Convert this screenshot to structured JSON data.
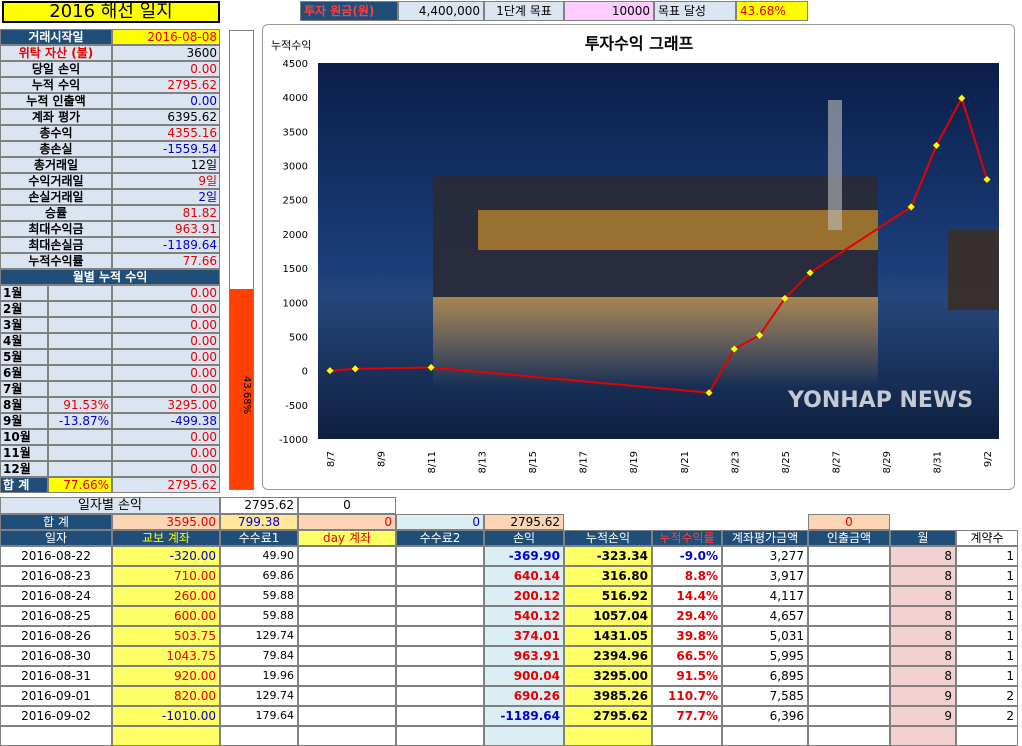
{
  "title": "2016 해선 일지",
  "top_bar": {
    "principal_label": "투자 원금(원)",
    "principal_value": "4,400,000",
    "stage_label": "1단계 목표",
    "stage_value": "10000",
    "goal_label": "목표 달성",
    "goal_value": "43.68%"
  },
  "summary": [
    {
      "label": "거래시작일",
      "value": "2016-08-08",
      "label_style": "hdr",
      "value_style": "yel-red"
    },
    {
      "label": "위탁 자산 (불)",
      "value": "3600",
      "label_style": "red",
      "value_style": "plain"
    },
    {
      "label": "당일 손익",
      "value": "0.00",
      "label_style": "plain",
      "value_style": "red"
    },
    {
      "label": "누적 수익",
      "value": "2795.62",
      "label_style": "plain",
      "value_style": "red"
    },
    {
      "label": "누적 인출액",
      "value": "0.00",
      "label_style": "plain",
      "value_style": "blue"
    },
    {
      "label": "계좌 평가",
      "value": "6395.62",
      "label_style": "plain",
      "value_style": "plain"
    },
    {
      "label": "총수익",
      "value": "4355.16",
      "label_style": "plain",
      "value_style": "red"
    },
    {
      "label": "총손실",
      "value": "-1559.54",
      "label_style": "plain",
      "value_style": "blue"
    },
    {
      "label": "총거래일",
      "value": "12일",
      "label_style": "plain",
      "value_style": "plain"
    },
    {
      "label": "수익거래일",
      "value": "9일",
      "label_style": "plain",
      "value_style": "red"
    },
    {
      "label": "손실거래일",
      "value": "2일",
      "label_style": "plain",
      "value_style": "blue"
    },
    {
      "label": "승률",
      "value": "81.82",
      "label_style": "plain",
      "value_style": "red"
    },
    {
      "label": "최대수익금",
      "value": "963.91",
      "label_style": "plain",
      "value_style": "red"
    },
    {
      "label": "최대손실금",
      "value": "-1189.64",
      "label_style": "plain",
      "value_style": "blue"
    },
    {
      "label": "누적수익률",
      "value": "77.66",
      "label_style": "plain",
      "value_style": "red"
    }
  ],
  "monthly_title": "월별 누적 수익",
  "monthly": [
    {
      "month": "1월",
      "pct": "",
      "value": "0.00"
    },
    {
      "month": "2월",
      "pct": "",
      "value": "0.00"
    },
    {
      "month": "3월",
      "pct": "",
      "value": "0.00"
    },
    {
      "month": "4월",
      "pct": "",
      "value": "0.00"
    },
    {
      "month": "5월",
      "pct": "",
      "value": "0.00"
    },
    {
      "month": "6월",
      "pct": "",
      "value": "0.00"
    },
    {
      "month": "7월",
      "pct": "",
      "value": "0.00"
    },
    {
      "month": "8월",
      "pct": "91.53%",
      "value": "3295.00"
    },
    {
      "month": "9월",
      "pct": "-13.87%",
      "value": "-499.38"
    },
    {
      "month": "10월",
      "pct": "",
      "value": "0.00"
    },
    {
      "month": "11월",
      "pct": "",
      "value": "0.00"
    },
    {
      "month": "12월",
      "pct": "",
      "value": "0.00"
    }
  ],
  "monthly_total": {
    "label": "합 계",
    "pct": "77.66%",
    "value": "2795.62"
  },
  "goal_bar": {
    "text": "43.68%",
    "fraction": 0.4368
  },
  "chart_data": {
    "type": "line",
    "title": "투자수익 그래프",
    "ylabel": "누적수익",
    "ylim": [
      -1000,
      4500
    ],
    "yticks": [
      4500,
      4000,
      3500,
      3000,
      2500,
      2000,
      1500,
      1000,
      500,
      0,
      -500,
      -1000
    ],
    "xtick_labels": [
      "8/7",
      "8/9",
      "8/11",
      "8/13",
      "8/15",
      "8/17",
      "8/19",
      "8/21",
      "8/23",
      "8/25",
      "8/27",
      "8/29",
      "8/31",
      "9/2"
    ],
    "x": [
      "8/7",
      "8/8",
      "8/11",
      "8/22",
      "8/23",
      "8/24",
      "8/25",
      "8/26",
      "8/30",
      "8/31",
      "9/1",
      "9/2"
    ],
    "values": [
      0,
      26.44,
      46.44,
      -323.34,
      316.8,
      516.92,
      1057.04,
      1431.05,
      2394.96,
      3295.0,
      3985.26,
      2795.62
    ],
    "line_color": "#e60000",
    "marker_color": "#ffff00",
    "background_watermark": "YONHAP NEWS"
  },
  "daily_header": {
    "title": "일자별 손익",
    "total_top": "2795.62",
    "zero_top": "0"
  },
  "totals_row": {
    "label": "합 계",
    "kyobo": "3595.00",
    "fee1": "799.38",
    "day": "0",
    "fee2": "0",
    "pl": "2795.62",
    "withdraw": "0"
  },
  "columns": [
    "일자",
    "교보 계좌",
    "수수료1",
    "day 계좌",
    "수수료2",
    "손익",
    "누적손익",
    "누적수익률",
    "계좌평가금액",
    "인출금액",
    "월",
    "계약수"
  ],
  "rows": [
    {
      "date": "2016-08-22",
      "kyobo": "-320.00",
      "fee1": "49.90",
      "pl": "-369.90",
      "cum": "-323.34",
      "rate": "-9.0%",
      "eval": "3,277",
      "month": "8",
      "qty": "1"
    },
    {
      "date": "2016-08-23",
      "kyobo": "710.00",
      "fee1": "69.86",
      "pl": "640.14",
      "cum": "316.80",
      "rate": "8.8%",
      "eval": "3,917",
      "month": "8",
      "qty": "1"
    },
    {
      "date": "2016-08-24",
      "kyobo": "260.00",
      "fee1": "59.88",
      "pl": "200.12",
      "cum": "516.92",
      "rate": "14.4%",
      "eval": "4,117",
      "month": "8",
      "qty": "1"
    },
    {
      "date": "2016-08-25",
      "kyobo": "600.00",
      "fee1": "59.88",
      "pl": "540.12",
      "cum": "1057.04",
      "rate": "29.4%",
      "eval": "4,657",
      "month": "8",
      "qty": "1"
    },
    {
      "date": "2016-08-26",
      "kyobo": "503.75",
      "fee1": "129.74",
      "pl": "374.01",
      "cum": "1431.05",
      "rate": "39.8%",
      "eval": "5,031",
      "month": "8",
      "qty": "1"
    },
    {
      "date": "2016-08-30",
      "kyobo": "1043.75",
      "fee1": "79.84",
      "pl": "963.91",
      "cum": "2394.96",
      "rate": "66.5%",
      "eval": "5,995",
      "month": "8",
      "qty": "1"
    },
    {
      "date": "2016-08-31",
      "kyobo": "920.00",
      "fee1": "19.96",
      "pl": "900.04",
      "cum": "3295.00",
      "rate": "91.5%",
      "eval": "6,895",
      "month": "8",
      "qty": "1"
    },
    {
      "date": "2016-09-01",
      "kyobo": "820.00",
      "fee1": "129.74",
      "pl": "690.26",
      "cum": "3985.26",
      "rate": "110.7%",
      "eval": "7,585",
      "month": "9",
      "qty": "2"
    },
    {
      "date": "2016-09-02",
      "kyobo": "-1010.00",
      "fee1": "179.64",
      "pl": "-1189.64",
      "cum": "2795.62",
      "rate": "77.7%",
      "eval": "6,396",
      "month": "9",
      "qty": "2"
    }
  ]
}
